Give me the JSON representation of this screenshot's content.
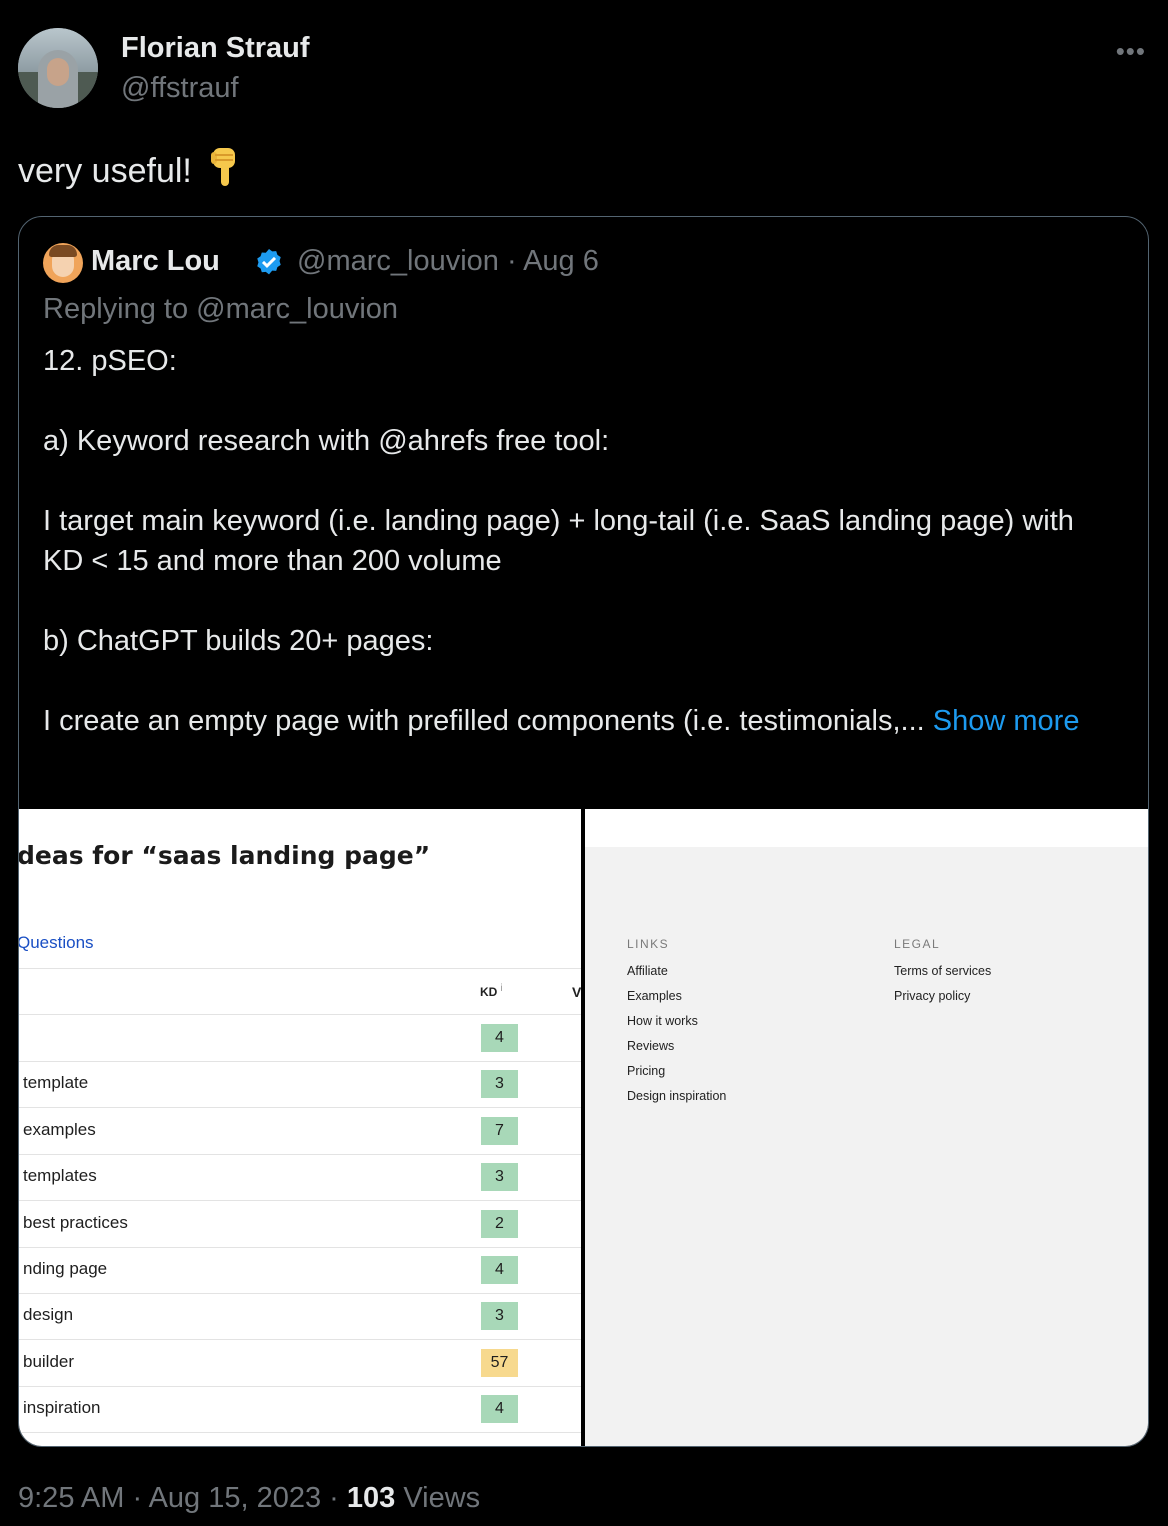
{
  "tweet": {
    "author_name": "Florian Strauf",
    "author_handle": "@ffstrauf",
    "more_icon": "more-horizontal-icon",
    "text": "very useful!",
    "emoji": "backhand-index-pointing-down",
    "time": "9:25 AM · Aug 15, 2023 ·",
    "views_count": "103",
    "views_label": "Views"
  },
  "quoted": {
    "author_name": "Marc Lou",
    "verified_icon": "verified-badge-icon",
    "verified_color": "#1d9bf0",
    "meta": "@marc_louvion · Aug 6",
    "replying_to": "Replying to @marc_louvion",
    "paragraphs": [
      "12. pSEO:",
      "",
      "a) Keyword research with @ahrefs free tool:",
      "",
      "I target main keyword (i.e. landing page) + long-tail (i.e. SaaS landing page) with KD < 15 and more than 200 volume",
      "",
      "b) ChatGPT builds 20+ pages:",
      ""
    ],
    "last_line": "I create an empty page with prefilled components (i.e. testimonials,...",
    "show_more": "Show more"
  },
  "media_left": {
    "title": "deas for “saas landing page”",
    "tab": "Questions",
    "kd_header": "KD",
    "kd_info": "i",
    "v_header": "V",
    "rows": [
      {
        "label": "",
        "kd": "4",
        "level": "green"
      },
      {
        "label": "template",
        "kd": "3",
        "level": "green"
      },
      {
        "label": "examples",
        "kd": "7",
        "level": "green"
      },
      {
        "label": "templates",
        "kd": "3",
        "level": "green"
      },
      {
        "label": "best practices",
        "kd": "2",
        "level": "green"
      },
      {
        "label": "nding page",
        "kd": "4",
        "level": "green"
      },
      {
        "label": "design",
        "kd": "3",
        "level": "green"
      },
      {
        "label": "builder",
        "kd": "57",
        "level": "yellow"
      },
      {
        "label": "inspiration",
        "kd": "4",
        "level": "green"
      }
    ]
  },
  "media_right": {
    "links_title": "LINKS",
    "links": [
      "Affiliate",
      "Examples",
      "How it works",
      "Reviews",
      "Pricing",
      "Design inspiration"
    ],
    "legal_title": "LEGAL",
    "legal": [
      "Terms of services",
      "Privacy policy"
    ]
  },
  "colors": {
    "link_blue": "#1d9bf0",
    "muted_gray": "#71767b",
    "kd_green": "#a8d8b8",
    "kd_yellow": "#f7d98e"
  }
}
